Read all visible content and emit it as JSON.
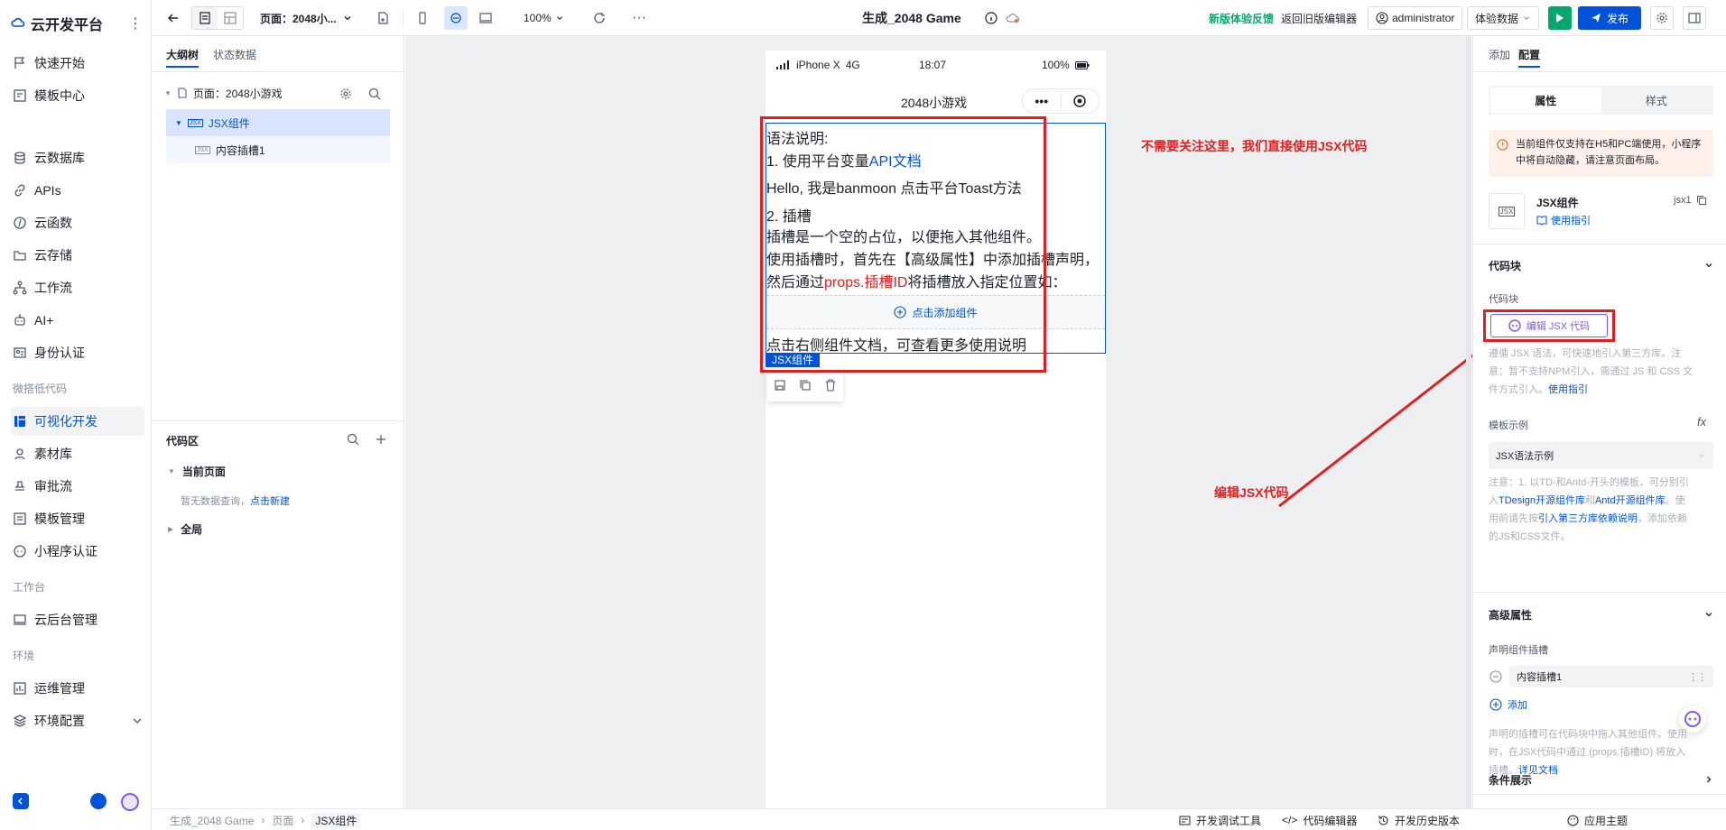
{
  "app": {
    "title": "云开发平台"
  },
  "nav": {
    "items": [
      {
        "label": "快速开始"
      },
      {
        "label": "模板中心"
      },
      {
        "label": "云数据库"
      },
      {
        "label": "APIs"
      },
      {
        "label": "云函数"
      },
      {
        "label": "云存储"
      },
      {
        "label": "工作流"
      },
      {
        "label": "AI+"
      },
      {
        "label": "身份认证"
      },
      {
        "label": "可视化开发"
      },
      {
        "label": "素材库"
      },
      {
        "label": "审批流"
      },
      {
        "label": "模板管理"
      },
      {
        "label": "小程序认证"
      },
      {
        "label": "云后台管理"
      },
      {
        "label": "运维管理"
      },
      {
        "label": "环境配置"
      }
    ],
    "groups": {
      "lowcode": "微搭低代码",
      "workbench": "工作台",
      "env": "环境"
    }
  },
  "topbar": {
    "page_select": "页面：2048小...",
    "zoom": "100%",
    "project_title": "生成_2048 Game",
    "feedback": "新版体验反馈",
    "back_old": "返回旧版编辑器",
    "user": "administrator",
    "data_select": "体验数据",
    "publish": "发布"
  },
  "outline": {
    "tabs": [
      "大纲树",
      "状态数据"
    ],
    "page_node": "页面：2048小游戏",
    "jsx_node": "JSX组件",
    "slot_node": "内容插槽1",
    "code_area": "代码区",
    "current_page": "当前页面",
    "no_data": "暂无数据查询，",
    "create_new": "点击新建",
    "global": "全局"
  },
  "phone": {
    "carrier": "iPhone X",
    "network": "4G",
    "time": "18:07",
    "battery": "100%",
    "nav_title": "2048小游戏",
    "line1": "语法说明:",
    "line2_prefix": "1. 使用平台变量",
    "line2_link": "API文档",
    "line3": "Hello, 我是banmoon 点击平台Toast方法",
    "line4": "2. 插槽",
    "line5": "插槽是一个空的占位，以便拖入其他组件。",
    "line6": "使用插槽时，首先在【高级属性】中添加插槽声明，",
    "line7_prefix": "然后通过",
    "line7_red": "props.插槽ID",
    "line7_suffix": "将插槽放入指定位置如：",
    "add_component": "点击添加组件",
    "line8": "点击右侧组件文档，可查看更多使用说明",
    "jsx_tag": "JSX组件"
  },
  "annotations": {
    "note1": "不需要关注这里，我们直接使用JSX代码",
    "note2": "编辑JSX代码",
    "color": "#e02020"
  },
  "right": {
    "tabs": [
      "添加",
      "配置"
    ],
    "seg": [
      "属性",
      "样式"
    ],
    "warning": "当前组件仅支持在H5和PC端使用，小程序中将自动隐藏，请注意页面布局。",
    "comp_name": "JSX组件",
    "comp_guide": "使用指引",
    "comp_id": "jsx1",
    "code_block_title": "代码块",
    "code_block_label": "代码块",
    "edit_jsx": "编辑 JSX 代码",
    "code_desc_1": "遵循 JSX 语法，可快速地引入第三方库。注",
    "code_desc_2": "意：暂不支持NPM引入，需通过 JS 和 CSS 文",
    "code_desc_3": "件方式引入。",
    "code_desc_link": "使用指引",
    "template_label": "模板示例",
    "template_value": "JSX语法示例",
    "template_note_1": "注意：1. 以TD-和Antd-开头的模板，可分别引",
    "template_note_2a": "入",
    "template_note_2b": "TDesign开源组件库",
    "template_note_2c": "和",
    "template_note_2d": "Antd开源组件库",
    "template_note_2e": "。使",
    "template_note_3a": "用前请先按",
    "template_note_3b": "引入第三方库依赖说明",
    "template_note_3c": "，添加依赖",
    "template_note_4": "的JS和CSS文件。",
    "advanced_title": "高级属性",
    "slot_declare": "声明组件插槽",
    "slot_item": "内容插槽1",
    "add": "添加",
    "slot_note_1": "声明的插槽可在代码块中拖入其他组件。使用",
    "slot_note_2": "时，在JSX代码中通过 (props.插槽ID) 将放入",
    "slot_note_3a": "插槽。",
    "slot_note_3b": "详见文档",
    "condition_title": "条件展示"
  },
  "bottombar": {
    "breadcrumb": [
      "生成_2048 Game",
      "页面",
      "JSX组件"
    ],
    "debug": "开发调试工具",
    "code_editor": "代码编辑器",
    "history": "开发历史版本",
    "theme": "应用主题"
  },
  "colors": {
    "primary": "#0052d9",
    "green": "#00a870",
    "annotation": "#e02020"
  }
}
